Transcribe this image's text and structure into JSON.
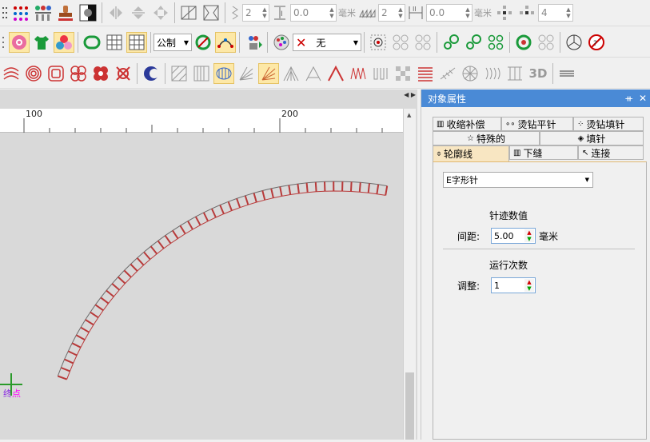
{
  "toolbar1": {
    "stitch_count": "2",
    "spacing_value": "0.0",
    "spacing_unit": "毫米",
    "count2": "2",
    "spacing2_value": "0.0",
    "spacing2_unit": "毫米",
    "copies": "4"
  },
  "toolbar2": {
    "unit_select": "公制",
    "fill_select": "无"
  },
  "toolbar3": {
    "label_3d": "3D"
  },
  "canvas": {
    "ruler": [
      "100",
      "200"
    ],
    "end_label_1": "终",
    "end_label_2": "点"
  },
  "panel": {
    "title": "对象属性",
    "pin": "ᚑ",
    "close": "✕",
    "tabs_row1": [
      "收缩补偿",
      "烫钻平针",
      "烫钻填针"
    ],
    "tabs_row2": [
      "特殊的",
      "填针"
    ],
    "tabs_row3": [
      "轮廓线",
      "下缝",
      "连接"
    ],
    "stitch_type": "E字形针",
    "section1_title": "针迹数值",
    "spacing_label": "间距:",
    "spacing_value": "5.00",
    "spacing_unit": "毫米",
    "section2_title": "运行次数",
    "adjust_label": "调整:",
    "adjust_value": "1"
  },
  "colors": {
    "accent_title": "#4a8ad6",
    "selected_tab": "#f8e6c2",
    "canvas": "#d9d9d9",
    "stitch": "#b83a3a"
  }
}
